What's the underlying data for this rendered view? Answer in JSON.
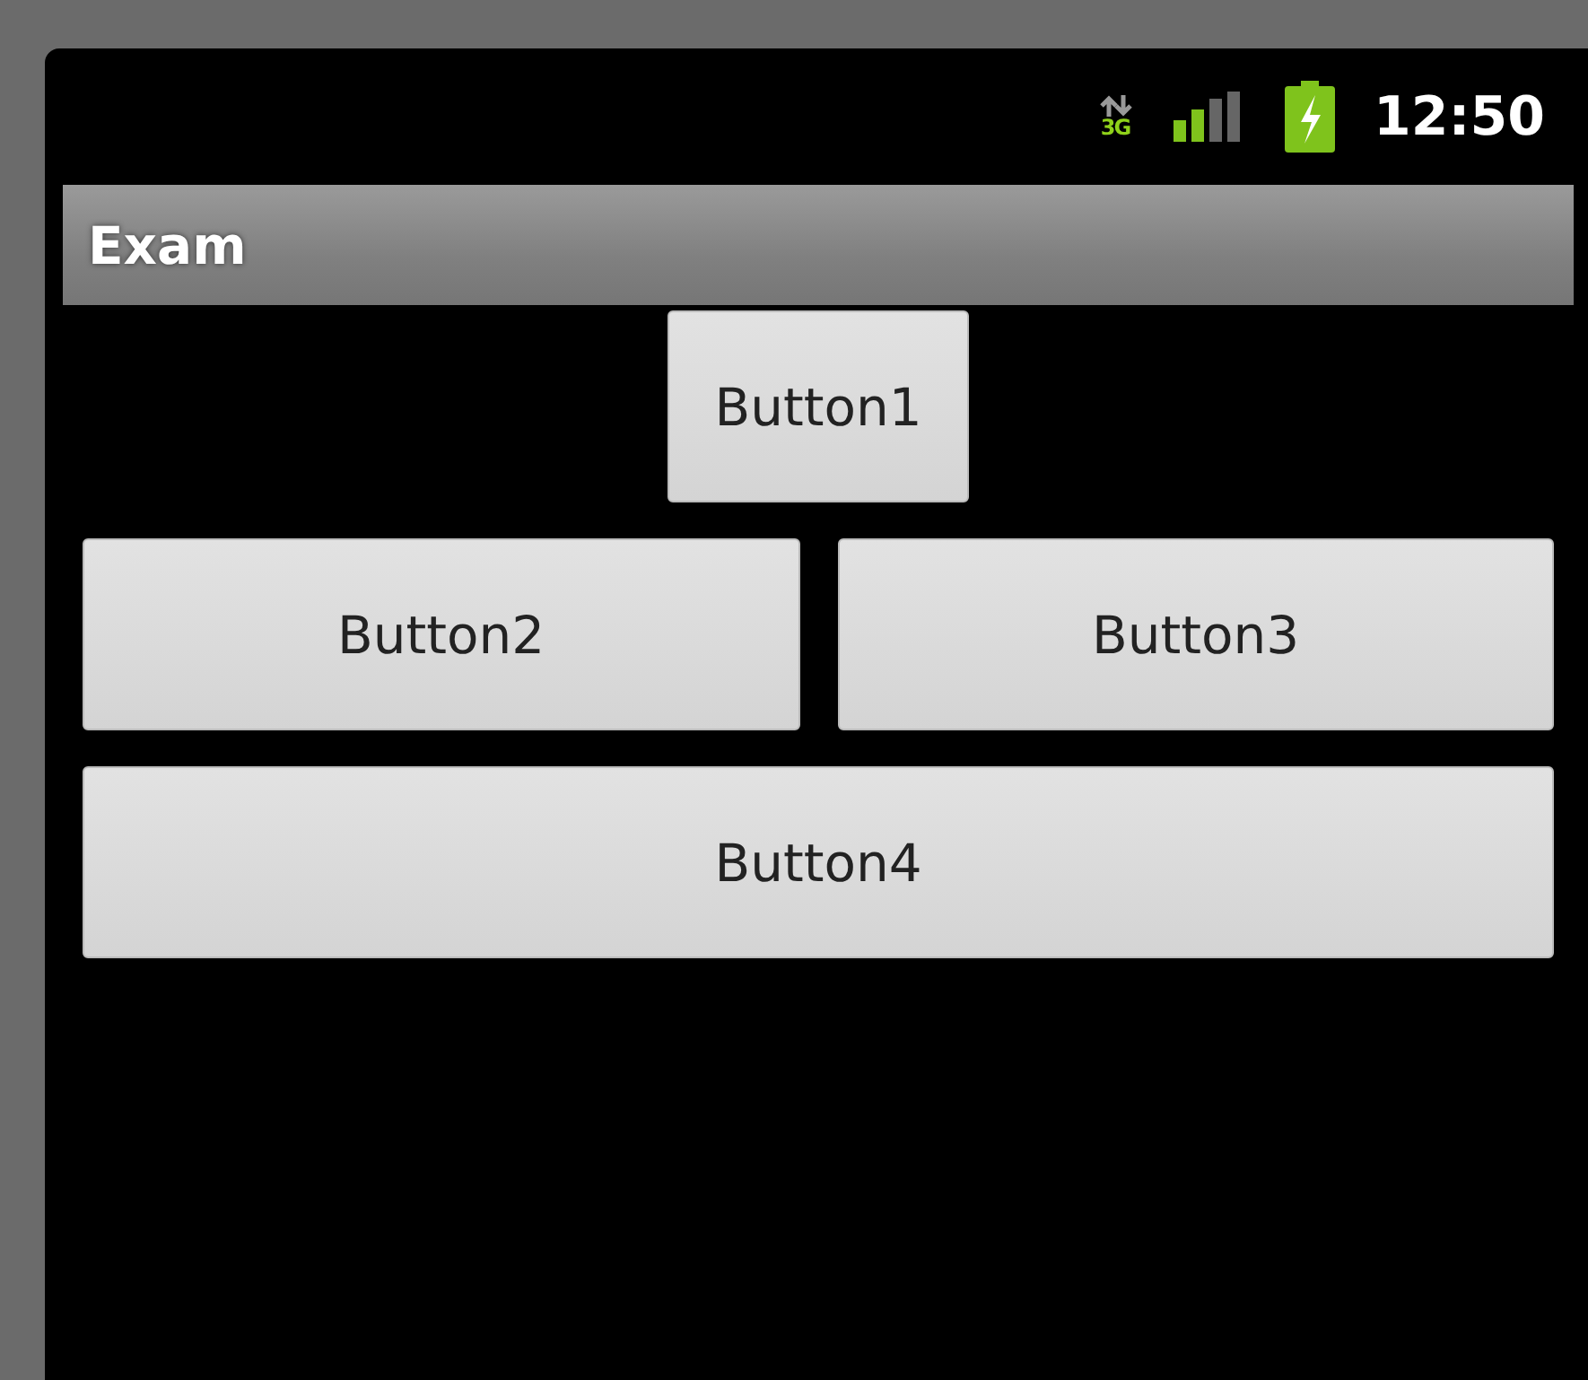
{
  "status_bar": {
    "network_type": "3G",
    "time": "12:50"
  },
  "title": "Exam",
  "buttons": [
    {
      "label": "Button1",
      "kind": "centered"
    },
    {
      "label": "Button2",
      "kind": "half"
    },
    {
      "label": "Button3",
      "kind": "half"
    },
    {
      "label": "Button4",
      "kind": "wide"
    }
  ]
}
